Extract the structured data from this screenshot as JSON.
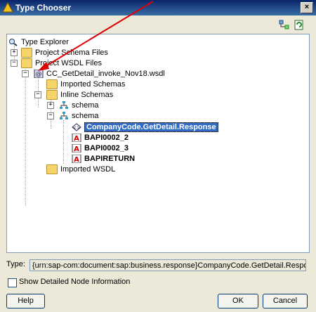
{
  "window": {
    "title": "Type Chooser",
    "close_label": "×"
  },
  "toolbar": {
    "icons": [
      "expand-tree-icon",
      "refresh-icon"
    ]
  },
  "tree": {
    "root": "Type Explorer",
    "project_schema_files": "Project Schema Files",
    "project_wsdl_files": "Project WSDL Files",
    "wsdl_file": "CC_GetDetail_invoke_Nov18.wsdl",
    "imported_schemas": "Imported Schemas",
    "inline_schemas": "Inline Schemas",
    "schema1": "schema",
    "schema2": "schema",
    "selected_element": "CompanyCode.GetDetail.Response",
    "bapi1": "BAPI0002_2",
    "bapi2": "BAPI0002_3",
    "bapireturn": "BAPIRETURN",
    "imported_wsdl": "Imported WSDL"
  },
  "type_field": {
    "label": "Type:",
    "value": "{urn:sap-com:document:sap:business.response}CompanyCode.GetDetail.Response"
  },
  "show_detail": {
    "label": "Show Detailed Node Information",
    "checked": false
  },
  "buttons": {
    "help": "Help",
    "ok": "OK",
    "cancel": "Cancel"
  },
  "colors": {
    "selection": "#316ac5",
    "arrow": "#e00000"
  }
}
